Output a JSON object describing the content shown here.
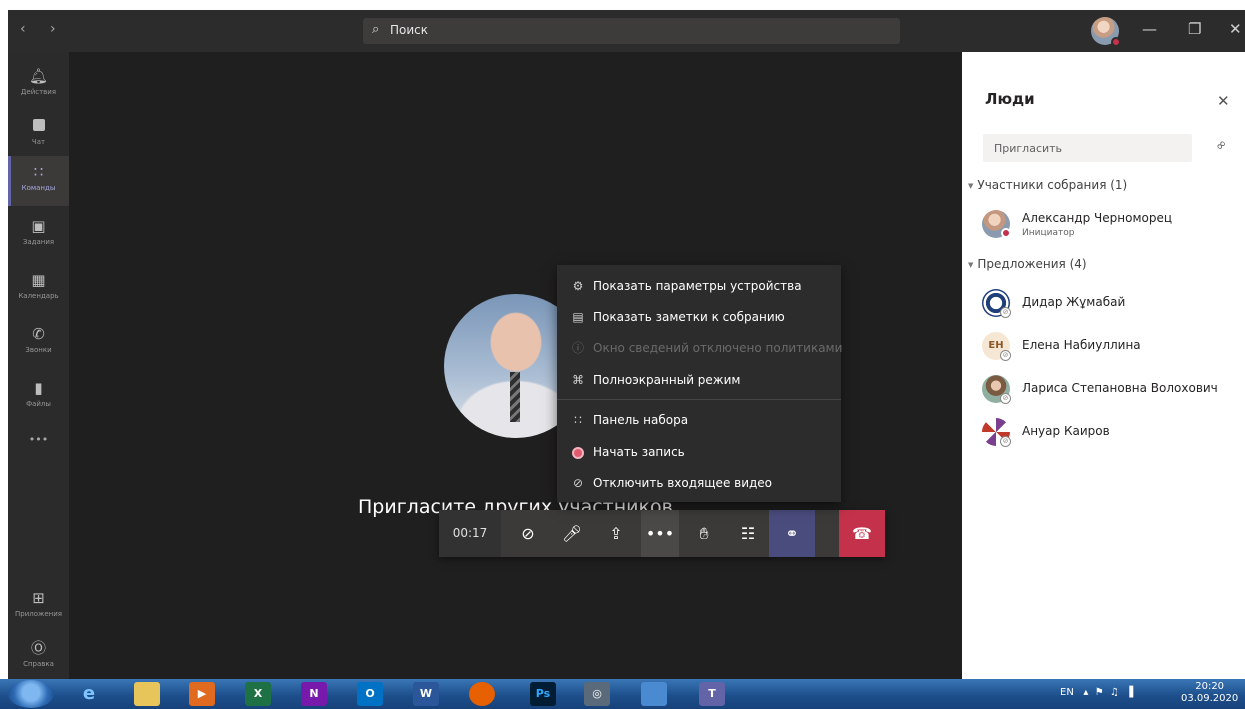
{
  "titlebar": {
    "nav_arrows": "‹   ›",
    "search_placeholder": "Поиск",
    "min_glyph": "—",
    "max_glyph": "❐",
    "close_glyph": "✕"
  },
  "rail": {
    "items": [
      {
        "label": "Действия",
        "icon": "bell-icon"
      },
      {
        "label": "Чат",
        "icon": "chat-icon"
      },
      {
        "label": "Команды",
        "icon": "teams-icon",
        "active": true
      },
      {
        "label": "Задания",
        "icon": "assignments-icon"
      },
      {
        "label": "Календарь",
        "icon": "calendar-icon"
      },
      {
        "label": "Звонки",
        "icon": "phone-icon"
      },
      {
        "label": "Файлы",
        "icon": "files-icon"
      }
    ],
    "more": "•••",
    "apps_label": "Приложения",
    "help_label": "Справка"
  },
  "stage": {
    "invite_text": "Пригласите других участников"
  },
  "toolbar": {
    "timer": "00:17",
    "buttons": [
      "camera-off-icon",
      "mic-icon",
      "share-screen-icon",
      "more-icon",
      "raise-hand-icon",
      "chat-icon",
      "participants-icon",
      "hang-up-icon"
    ]
  },
  "menu": {
    "items": [
      {
        "label": "Показать параметры устройства",
        "icon": "gear-icon"
      },
      {
        "label": "Показать заметки к собранию",
        "icon": "notes-icon"
      },
      {
        "label": "Окно сведений отключено политиками",
        "icon": "info-icon",
        "disabled": true
      },
      {
        "label": "Полноэкранный режим",
        "icon": "fullscreen-icon"
      },
      {
        "label": "Панель набора",
        "icon": "dialpad-icon"
      },
      {
        "label": "Начать запись",
        "icon": "record-icon"
      },
      {
        "label": "Отключить входящее видео",
        "icon": "video-off-icon"
      }
    ]
  },
  "people": {
    "title": "Люди",
    "invite_placeholder": "Пригласить",
    "participants_header": "Участники собрания (1)",
    "participants": [
      {
        "name": "Александр Черноморец",
        "role": "Инициатор"
      }
    ],
    "suggestions_header": "Предложения (4)",
    "suggestions": [
      {
        "name": "Дидар Жұмабай"
      },
      {
        "name": "Елена Набиуллина",
        "initials": "ЕН"
      },
      {
        "name": "Лариса Степановна Волохович"
      },
      {
        "name": "Ануар Каиров"
      }
    ]
  },
  "taskbar": {
    "apps": [
      "IE",
      "Files",
      "Media",
      "X",
      "N",
      "O",
      "W",
      "Firefox",
      "Ps",
      "Camera",
      "Paint",
      "Teams"
    ],
    "lang": "EN",
    "time": "20:20",
    "date": "03.09.2020"
  },
  "colors": {
    "accent": "#6264a7",
    "hangup": "#c4314b",
    "stage_bg": "#201f1f"
  }
}
